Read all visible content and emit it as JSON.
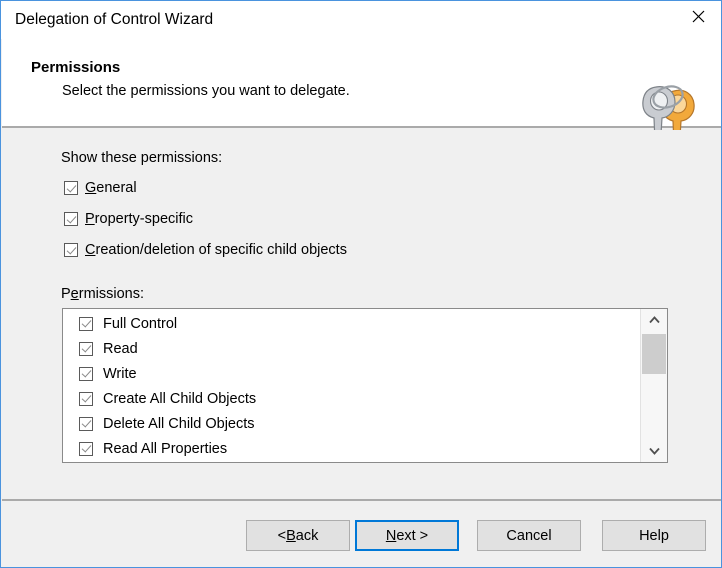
{
  "window": {
    "title": "Delegation of Control Wizard",
    "close_icon": "close-icon",
    "accent_color": "#4a93de"
  },
  "header": {
    "title": "Permissions",
    "subtitle": "Select the permissions you want to delegate.",
    "icon": "keys-icon"
  },
  "body": {
    "show_label": "Show these permissions:",
    "filter_checkboxes": [
      {
        "label_pre": "",
        "accel": "G",
        "label_post": "eneral",
        "checked": true
      },
      {
        "label_pre": "",
        "accel": "P",
        "label_post": "roperty-specific",
        "checked": true
      },
      {
        "label_pre": "",
        "accel": "C",
        "label_post": "reation/deletion of specific child objects",
        "checked": true
      }
    ],
    "permissions_label_pre": "P",
    "permissions_label_accel": "e",
    "permissions_label_post": "rmissions:",
    "permissions_list": [
      {
        "label": "Full Control",
        "checked": true
      },
      {
        "label": "Read",
        "checked": true
      },
      {
        "label": "Write",
        "checked": true
      },
      {
        "label": "Create All Child Objects",
        "checked": true
      },
      {
        "label": "Delete All Child Objects",
        "checked": true
      },
      {
        "label": "Read All Properties",
        "checked": true
      },
      {
        "label": "",
        "checked": true
      }
    ],
    "scrollbar": {
      "up_icon": "chevron-up-icon",
      "down_icon": "chevron-down-icon"
    }
  },
  "footer": {
    "buttons": [
      {
        "id": "back",
        "pre": "< ",
        "accel": "B",
        "post": "ack",
        "default": false
      },
      {
        "id": "next",
        "pre": "",
        "accel": "N",
        "post": "ext >",
        "default": true
      },
      {
        "id": "cancel",
        "pre": "Cancel",
        "accel": "",
        "post": "",
        "default": false
      },
      {
        "id": "help",
        "pre": "Help",
        "accel": "",
        "post": "",
        "default": false
      }
    ]
  }
}
